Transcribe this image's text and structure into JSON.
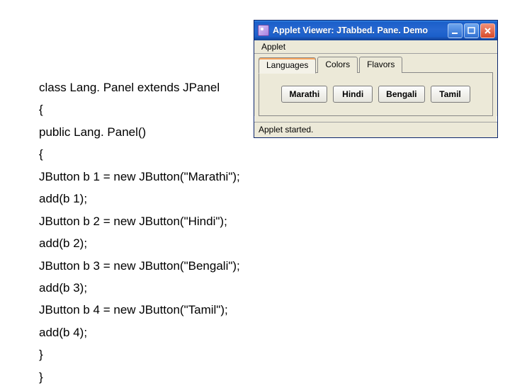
{
  "code": {
    "lines": [
      "class Lang. Panel extends JPanel",
      "{",
      "public Lang. Panel()",
      "{",
      "JButton b 1 = new JButton(\"Marathi\");",
      "add(b 1);",
      "JButton b 2 = new JButton(\"Hindi\");",
      "add(b 2);",
      "JButton b 3 = new JButton(\"Bengali\");",
      "add(b 3);",
      "JButton b 4 = new JButton(\"Tamil\");",
      "add(b 4);",
      "}",
      "}"
    ]
  },
  "window": {
    "title": "Applet Viewer: JTabbed. Pane. Demo",
    "menu": "Applet",
    "tabs": [
      {
        "label": "Languages",
        "active": true
      },
      {
        "label": "Colors",
        "active": false
      },
      {
        "label": "Flavors",
        "active": false
      }
    ],
    "buttons": [
      "Marathi",
      "Hindi",
      "Bengali",
      "Tamil"
    ],
    "status": "Applet started."
  },
  "icons": {
    "minimize": "minimize-icon",
    "maximize": "maximize-icon",
    "close": "close-icon",
    "app": "java-applet-icon"
  }
}
